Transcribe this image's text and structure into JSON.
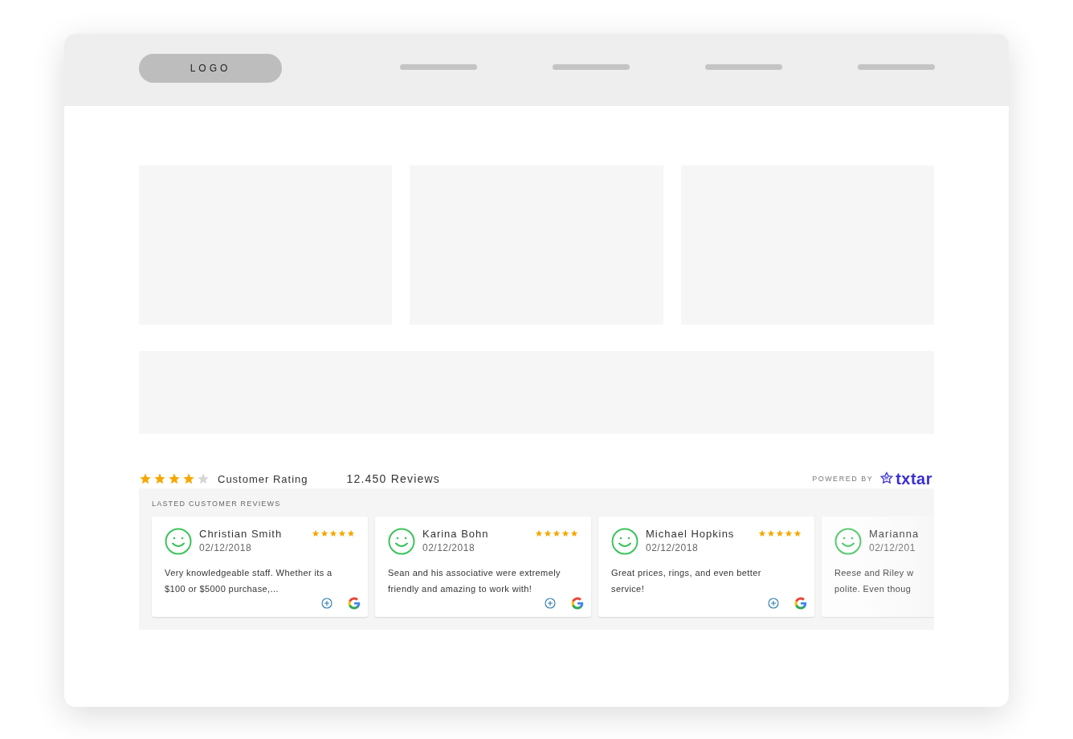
{
  "header": {
    "logo": "LOGO"
  },
  "rating": {
    "stars": 4,
    "label": "Customer Rating",
    "count": "12.450",
    "count_label": "Reviews",
    "powered_by": "POWERED BY",
    "brand": "txtar"
  },
  "reviews": {
    "title": "LASTED CUSTOMER REVIEWS",
    "items": [
      {
        "kind": "full",
        "name": "Christian Smith",
        "date": "02/12/2018",
        "stars": 5,
        "lines": [
          "Very knowledgeable staff. Whether its a",
          "$100 or $5000 purchase,..."
        ]
      },
      {
        "kind": "full",
        "name": "Karina Bohn",
        "date": "02/12/2018",
        "stars": 5,
        "lines": [
          "Sean and his associative were extremely",
          "friendly and amazing to work with!"
        ]
      },
      {
        "kind": "full",
        "name": "Michael Hopkins",
        "date": "02/12/2018",
        "stars": 5,
        "lines": [
          "Great prices, rings, and even better",
          "service!"
        ]
      },
      {
        "kind": "partial",
        "name": "Marianna",
        "date": "02/12/201",
        "lines": [
          "Reese and Riley w",
          "polite. Even thoug"
        ]
      }
    ]
  }
}
